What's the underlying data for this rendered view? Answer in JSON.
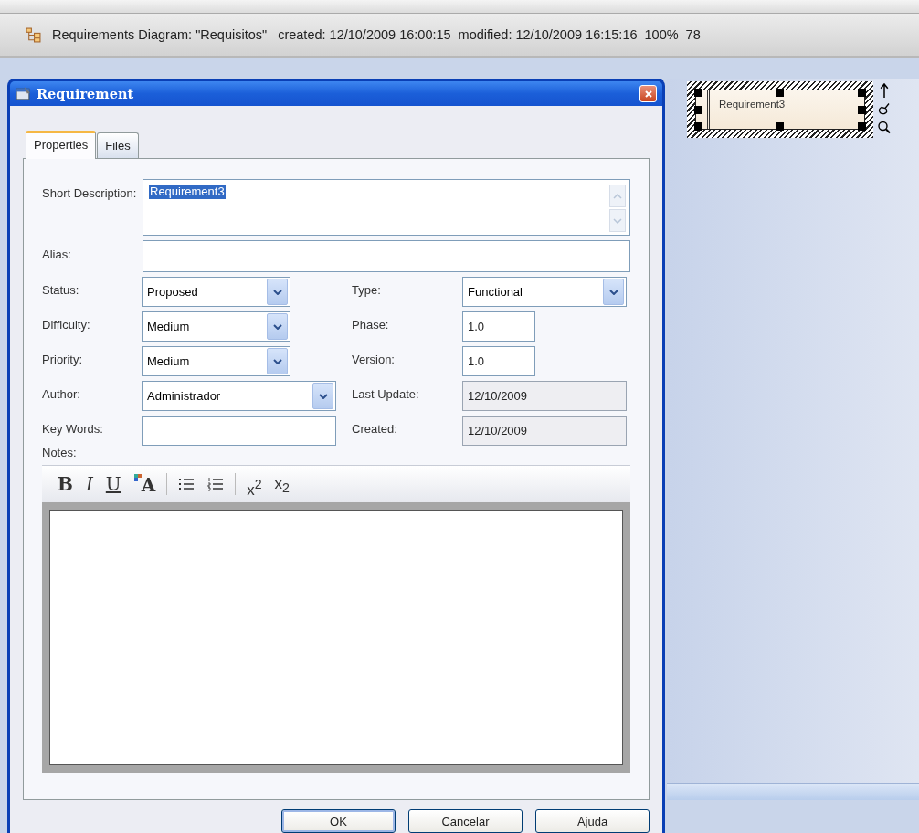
{
  "status_bar": {
    "texts": [
      "Requirements Diagram: \"Requisitos\"",
      "created: 12/10/2009 16:00:15",
      "modified: 12/10/2009 16:15:16",
      "100%",
      "78"
    ]
  },
  "dialog": {
    "title": "Requirement",
    "tabs": [
      {
        "label": "Properties",
        "selected": true
      },
      {
        "label": "Files",
        "selected": false
      }
    ],
    "short_description": {
      "label": "Short Description:",
      "value": "Requirement3",
      "text_selected": true
    },
    "alias": {
      "label": "Alias:"
    },
    "rows": [
      {
        "left": {
          "label": "Status:",
          "kind": "combo",
          "value": "Proposed"
        },
        "right": {
          "label": "Type:",
          "kind": "combo",
          "value": "Functional"
        }
      },
      {
        "left": {
          "label": "Difficulty:",
          "kind": "combo",
          "value": "Medium"
        },
        "right": {
          "label": "Phase:",
          "kind": "short-text",
          "value": "1.0"
        }
      },
      {
        "left": {
          "label": "Priority:",
          "kind": "combo",
          "value": "Medium"
        },
        "right": {
          "label": "Version:",
          "kind": "short-text",
          "value": "1.0"
        }
      },
      {
        "left": {
          "label": "Author:",
          "kind": "wide-combo",
          "value": "Administrador"
        },
        "right": {
          "label": "Last Update:",
          "kind": "readonly",
          "value": "12/10/2009"
        }
      },
      {
        "left": {
          "label": "Key Words:",
          "kind": "text"
        },
        "right": {
          "label": "Created:",
          "kind": "readonly",
          "value": "12/10/2009"
        }
      }
    ],
    "notes_label": "Notes:",
    "toolbar": [
      {
        "kind": "bold",
        "text": "B"
      },
      {
        "kind": "italic",
        "text": "I"
      },
      {
        "kind": "underline",
        "text": "U"
      },
      {
        "kind": "color",
        "text": "A"
      },
      {
        "kind": "separator"
      },
      {
        "kind": "bullets"
      },
      {
        "kind": "numbering"
      },
      {
        "kind": "separator"
      },
      {
        "kind": "text",
        "text": "x$^{2}$"
      },
      {
        "kind": "text",
        "text": "x$_{2}$"
      }
    ],
    "buttons": [
      {
        "label": "OK",
        "default": true
      },
      {
        "label": "Cancelar",
        "default": false
      },
      {
        "label": "Ajuda",
        "default": false
      }
    ]
  },
  "diagram": {
    "element": {
      "name": "Requirement3",
      "selected": true
    }
  }
}
